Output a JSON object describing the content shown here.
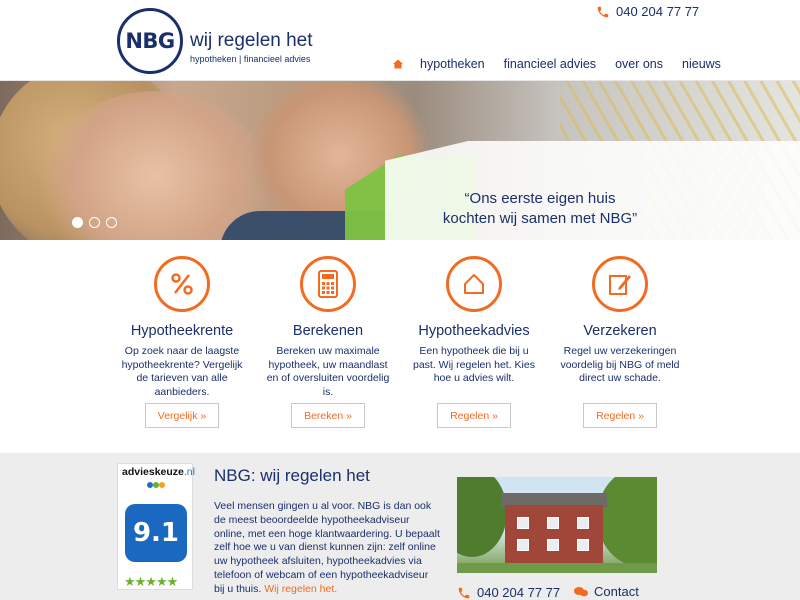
{
  "header": {
    "logo_text": "NBG",
    "tagline": "wij regelen het",
    "subtagline": "hypotheken | financieel advies",
    "phone": "040 204 77 77",
    "nav": [
      {
        "label": "hypotheken"
      },
      {
        "label": "financieel advies"
      },
      {
        "label": "over ons"
      },
      {
        "label": "nieuws"
      }
    ]
  },
  "hero": {
    "quote_line1": "“Ons eerste eigen huis",
    "quote_line2": "kochten wij samen met NBG”",
    "slides": 3,
    "active_slide": 1
  },
  "features": [
    {
      "icon": "percent-icon",
      "title": "Hypotheekrente",
      "text": "Op zoek naar de laagste hypotheekrente? Vergelijk de tarieven van alle aanbieders.",
      "button": "Vergelijk  »"
    },
    {
      "icon": "calculator-icon",
      "title": "Berekenen",
      "text": "Bereken uw maximale hypotheek, uw maandlast en of oversluiten voordelig is.",
      "button": "Bereken  »"
    },
    {
      "icon": "house-icon",
      "title": "Hypotheekadvies",
      "text": "Een hypotheek die bij u past. Wij regelen het. Kies hoe u advies wilt.",
      "button": "Regelen  »"
    },
    {
      "icon": "pencil-icon",
      "title": "Verzekeren",
      "text": "Regel uw verzekeringen voordelig bij NBG of meld direct uw schade.",
      "button": "Regelen  »"
    }
  ],
  "badge": {
    "title": "advieskeuze",
    "title_suffix": ".nl",
    "score": "9.1",
    "stars": "★★★★★"
  },
  "about": {
    "title": "NBG: wij regelen het",
    "text": "Veel mensen gingen u al voor. NBG is dan ook de meest beoordeelde hypotheekadviseur online, met een hoge klantwaardering. U bepaalt zelf hoe we u van dienst kunnen zijn: zelf online uw hypotheek afsluiten, hypotheekadvies via telefoon of webcam of een hypotheekadviseur bij u thuis.",
    "link": "Wij regelen het.",
    "phone": "040 204 77 77",
    "contact": "Contact"
  },
  "colors": {
    "navy": "#1a2f6b",
    "orange": "#f26b21",
    "green": "#7dc242",
    "badge_blue": "#1a68c0"
  }
}
